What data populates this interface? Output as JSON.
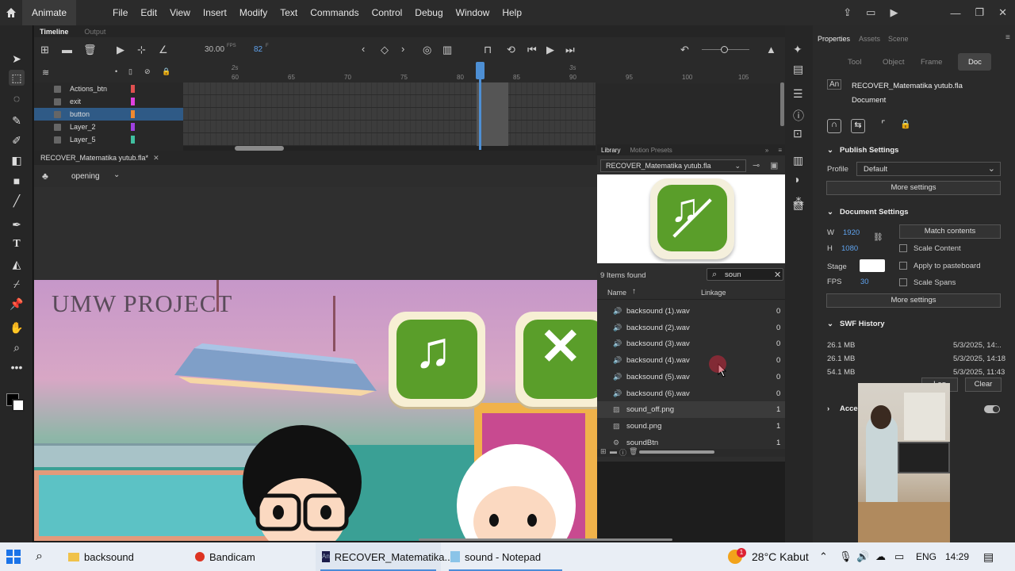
{
  "app": {
    "name": "Animate"
  },
  "menu": [
    "File",
    "Edit",
    "View",
    "Insert",
    "Modify",
    "Text",
    "Commands",
    "Control",
    "Debug",
    "Window",
    "Help"
  ],
  "timeline": {
    "tabs": [
      "Timeline",
      "Output"
    ],
    "fps": "30.00",
    "fps_unit": "FPS",
    "frame": "82",
    "frame_unit": "F",
    "ruler_seconds": [
      "2s",
      "3s"
    ],
    "ruler_numbers": [
      "60",
      "65",
      "70",
      "75",
      "80",
      "85",
      "90",
      "95",
      "100",
      "105"
    ],
    "layers": [
      {
        "name": "Actions_btn",
        "color": "#e05050"
      },
      {
        "name": "exit",
        "color": "#e040e0"
      },
      {
        "name": "button",
        "color": "#f08a30",
        "selected": true
      },
      {
        "name": "Layer_2",
        "color": "#a040e0"
      },
      {
        "name": "Layer_5",
        "color": "#40c0a0"
      }
    ]
  },
  "document": {
    "tab": "RECOVER_Matematika yutub.fla*",
    "scene": "opening",
    "stage_title": "UMW PROJECT"
  },
  "library": {
    "tabs": [
      "Library",
      "Motion Presets"
    ],
    "file": "RECOVER_Matematika yutub.fla",
    "found": "9 Items found",
    "search": "soun",
    "col_name": "Name",
    "col_linkage": "Linkage",
    "items": [
      {
        "name": "backsound (1).wav",
        "count": "0",
        "type": "sound"
      },
      {
        "name": "backsound (2).wav",
        "count": "0",
        "type": "sound"
      },
      {
        "name": "backsound (3).wav",
        "count": "0",
        "type": "sound"
      },
      {
        "name": "backsound (4).wav",
        "count": "0",
        "type": "sound"
      },
      {
        "name": "backsound (5).wav",
        "count": "0",
        "type": "sound"
      },
      {
        "name": "backsound (6).wav",
        "count": "0",
        "type": "sound"
      },
      {
        "name": "sound_off.png",
        "count": "1",
        "type": "bitmap",
        "selected": true
      },
      {
        "name": "sound.png",
        "count": "1",
        "type": "bitmap"
      },
      {
        "name": "soundBtn",
        "count": "1",
        "type": "symbol"
      }
    ]
  },
  "properties": {
    "tabs": [
      "Properties",
      "Assets",
      "Scene"
    ],
    "subtabs": [
      "Tool",
      "Object",
      "Frame",
      "Doc"
    ],
    "doc_name": "RECOVER_Matematika yutub.fla",
    "doc_type": "Document",
    "publish": {
      "title": "Publish Settings",
      "profile_label": "Profile",
      "profile": "Default",
      "more": "More settings"
    },
    "docsettings": {
      "title": "Document Settings",
      "w_label": "W",
      "w": "1920",
      "h_label": "H",
      "h": "1080",
      "match": "Match contents",
      "scale_content": "Scale Content",
      "stage": "Stage",
      "apply_paste": "Apply to pasteboard",
      "fps_label": "FPS",
      "fps": "30",
      "scale_spans": "Scale Spans",
      "more": "More settings"
    },
    "swf": {
      "title": "SWF History",
      "rows": [
        [
          "26.1 MB",
          "5/3/2025, 14:.."
        ],
        [
          "26.1 MB",
          "5/3/2025, 14:18"
        ],
        [
          "54.1 MB",
          "5/3/2025, 11:43"
        ]
      ],
      "log": "Log",
      "clear": "Clear"
    },
    "access_title": "Access"
  },
  "taskbar": {
    "items": [
      "backsound",
      "Bandicam",
      "RECOVER_Matematika...",
      "sound - Notepad"
    ],
    "weather": "28°C  Kabut",
    "lang": "ENG",
    "time": "14:29",
    "badge": "1"
  }
}
